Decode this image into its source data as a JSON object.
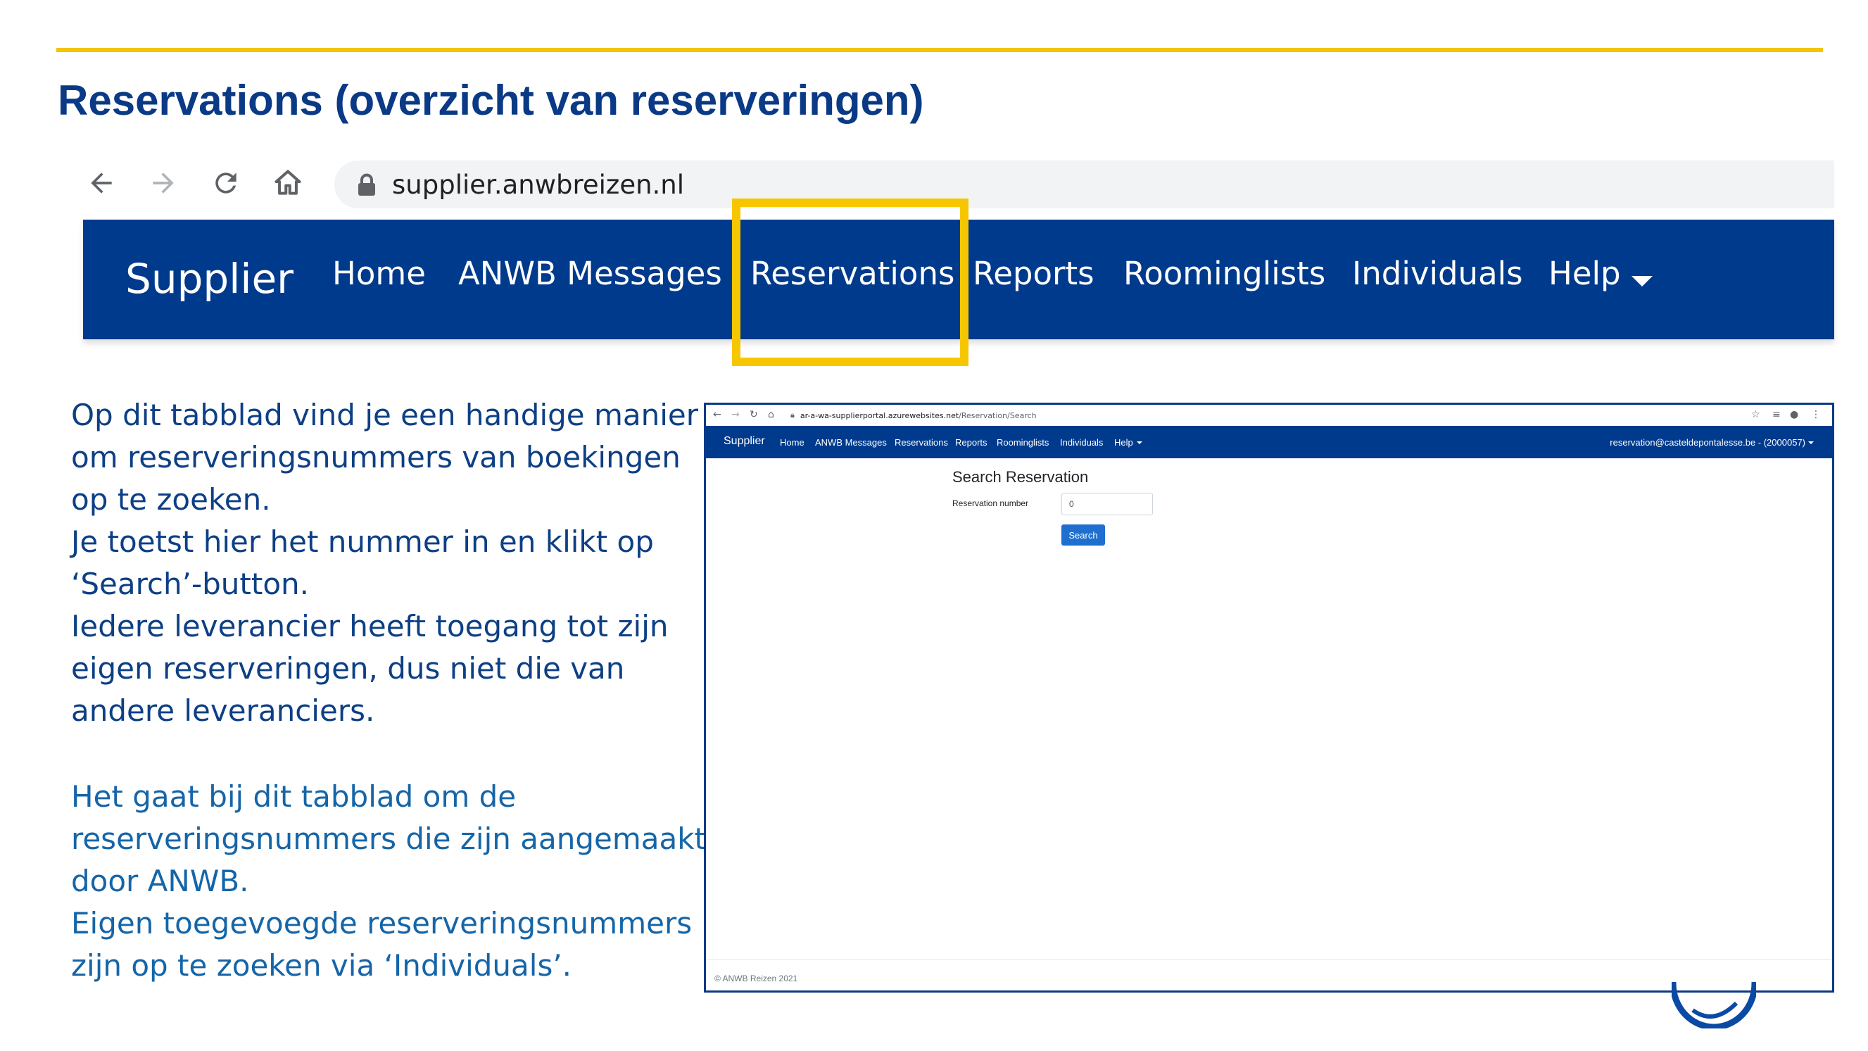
{
  "slide": {
    "title": "Reservations (overzicht van reserveringen)"
  },
  "zoomed_browser": {
    "url": "supplier.anwbreizen.nl",
    "nav_icons": [
      "back-arrow-icon",
      "forward-arrow-icon",
      "reload-icon",
      "home-icon",
      "lock-icon"
    ]
  },
  "zoomed_navbar": {
    "brand": "Supplier",
    "items": {
      "home": "Home",
      "messages": "ANWB Messages",
      "reservations": "Reservations",
      "reports": "Reports",
      "roominglists": "Roominglists",
      "individuals": "Individuals",
      "help": "Help"
    }
  },
  "description": {
    "block1": [
      "Op dit tabblad vind je een handige manier",
      "om reserveringsnummers van boekingen",
      "op te zoeken.",
      "Je toetst hier het nummer in en klikt op",
      "‘Search’-button.",
      "Iedere leverancier heeft toegang tot zijn",
      "eigen reserveringen, dus niet die van",
      "andere leveranciers."
    ],
    "block2": [
      "Het gaat bij dit tabblad om de",
      "reserveringsnummers die zijn aangemaakt",
      "door ANWB.",
      "Eigen toegevoegde reserveringsnummers",
      "zijn op te zoeken via ‘Individuals’."
    ]
  },
  "screenshot": {
    "url_host": "ar-a-wa-supplierportal.azurewebsites.net",
    "url_path": "/Reservation/Search",
    "navbar": {
      "brand": "Supplier",
      "home": "Home",
      "messages": "ANWB Messages",
      "reservations": "Reservations",
      "reports": "Reports",
      "roominglists": "Roominglists",
      "individuals": "Individuals",
      "help": "Help",
      "user": "reservation@casteldepontalesse.be - (2000057)"
    },
    "form": {
      "heading": "Search Reservation",
      "label": "Reservation number",
      "value": "0",
      "button": "Search"
    },
    "footer": "© ANWB Reizen 2021"
  },
  "colors": {
    "accent_yellow": "#f4c400",
    "navy": "#003a8c",
    "title_blue": "#0a3a85",
    "button_blue": "#1f6fd0"
  }
}
